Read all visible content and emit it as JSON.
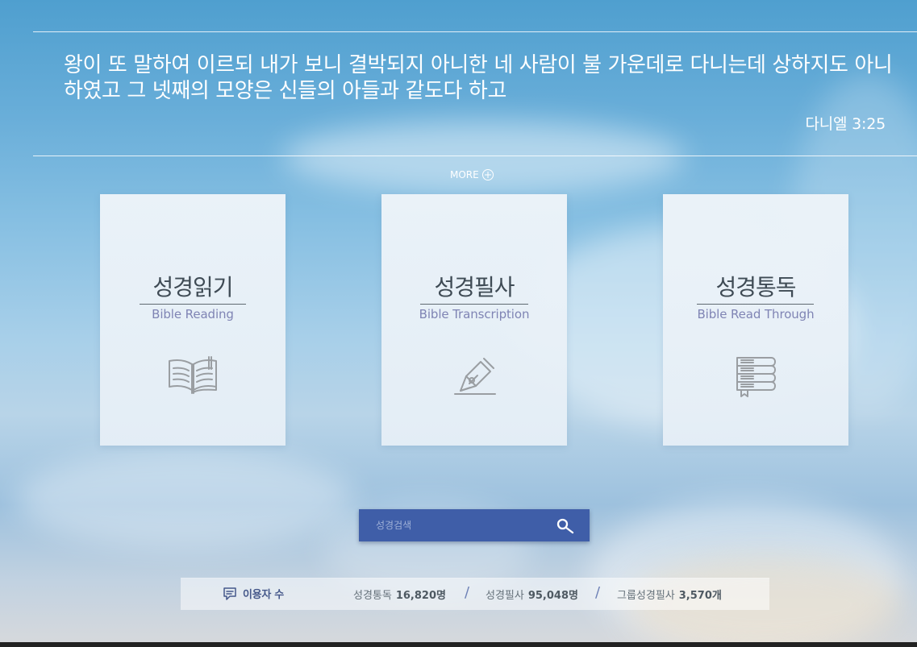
{
  "verse": {
    "text": "왕이 또 말하여 이르되 내가 보니 결박되지 아니한 네 사람이 불 가운데로 다니는데 상하지도 아니하였고 그 넷째의 모양은 신들의 아들과 같도다 하고",
    "reference": "다니엘 3:25"
  },
  "more": {
    "label": "MORE",
    "icon": "plus-circle-icon"
  },
  "cards": [
    {
      "title": "성경읽기",
      "subtitle": "Bible Reading",
      "icon": "open-book-icon"
    },
    {
      "title": "성경필사",
      "subtitle": "Bible Transcription",
      "icon": "fountain-pen-icon"
    },
    {
      "title": "성경통독",
      "subtitle": "Bible Read Through",
      "icon": "stacked-books-icon"
    }
  ],
  "search": {
    "placeholder": "성경검색",
    "icon": "search-icon"
  },
  "stats": {
    "label": "이용자 수",
    "icon": "speech-bubble-icon",
    "items": [
      {
        "label": "성경통독",
        "value": "16,820명"
      },
      {
        "label": "성경필사",
        "value": "95,048명"
      },
      {
        "label": "그룹성경필사",
        "value": "3,570개"
      }
    ],
    "separator": "/"
  },
  "colors": {
    "search_blue": "#3f5ea8",
    "card_subtitle": "#7f84b4",
    "stats_label": "#45588a"
  }
}
